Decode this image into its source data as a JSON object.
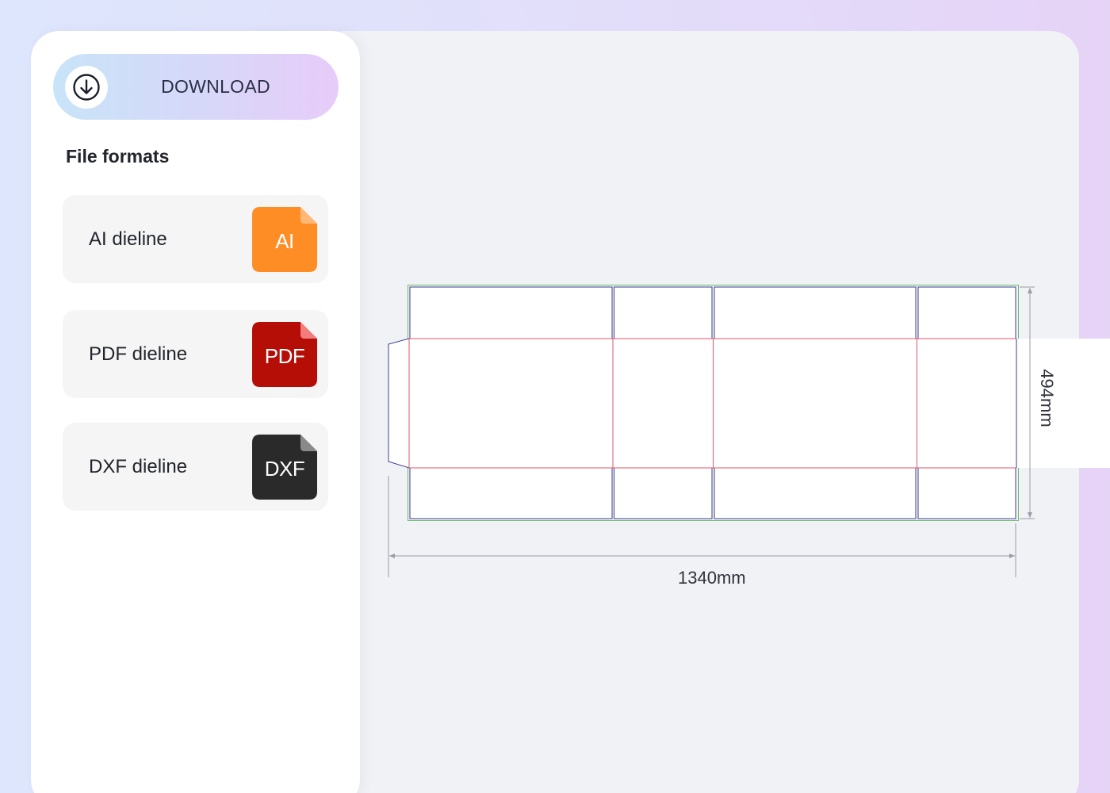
{
  "download": {
    "label": "DOWNLOAD",
    "icon": "download-circle-arrow-icon"
  },
  "file_formats": {
    "title": "File formats",
    "items": [
      {
        "label": "AI dieline",
        "icon_text": "AI",
        "icon_color": "#ff8d26"
      },
      {
        "label": "PDF dieline",
        "icon_text": "PDF",
        "icon_color": "#b40e07"
      },
      {
        "label": "DXF dieline",
        "icon_text": "DXF",
        "icon_color": "#2a2a2a"
      }
    ]
  },
  "dieline": {
    "width_label": "1340mm",
    "height_label": "494mm",
    "colors": {
      "cut": "#3a3f8f",
      "fold": "#e0556a",
      "bleed": "#6cbb6c",
      "dimension": "#9a9ca6"
    }
  }
}
